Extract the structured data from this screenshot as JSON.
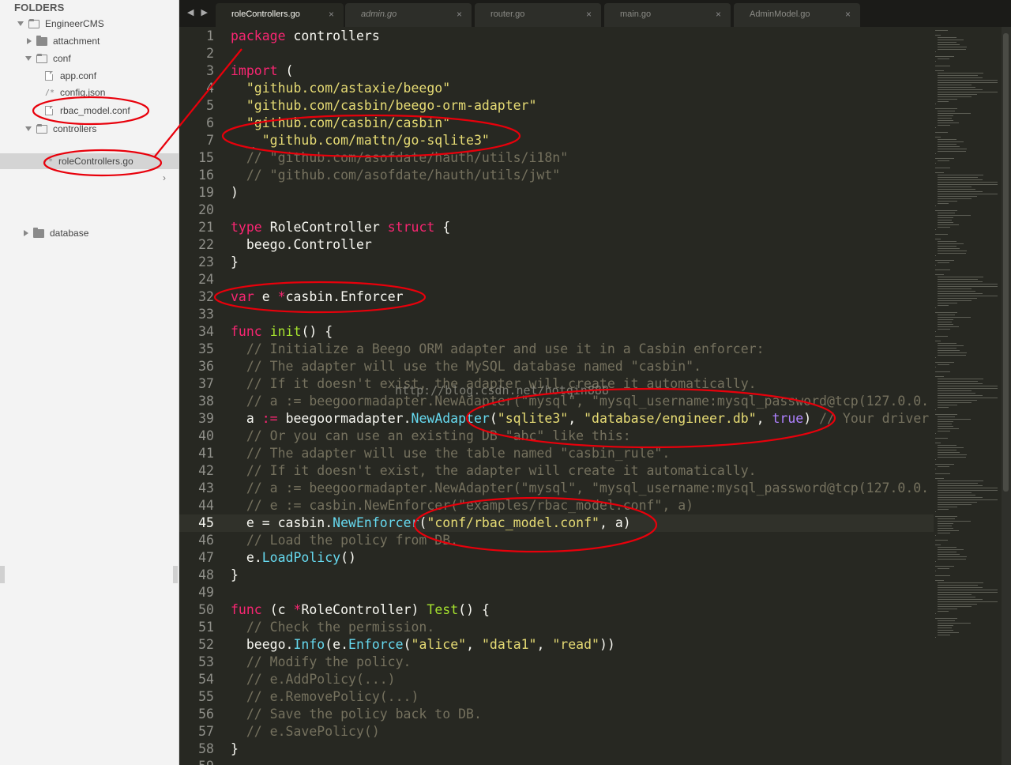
{
  "sidebar": {
    "header": "FOLDERS",
    "items": [
      {
        "label": "EngineerCMS",
        "kind": "folder-open"
      },
      {
        "label": "attachment",
        "kind": "folder"
      },
      {
        "label": "conf",
        "kind": "folder-open"
      },
      {
        "label": "app.conf",
        "kind": "file"
      },
      {
        "label": "config.json",
        "kind": "code-file",
        "glyph": "/*"
      },
      {
        "label": "rbac_model.conf",
        "kind": "file"
      },
      {
        "label": "controllers",
        "kind": "folder-open"
      },
      {
        "label": "roleControllers.go",
        "kind": "code-file",
        "glyph": "/*"
      },
      {
        "label": "database",
        "kind": "folder"
      }
    ],
    "collapse_chevron": "›"
  },
  "tabs": [
    {
      "label": "roleControllers.go",
      "active": true
    },
    {
      "label": "admin.go",
      "active": false
    },
    {
      "label": "router.go",
      "active": false
    },
    {
      "label": "main.go",
      "active": false
    },
    {
      "label": "AdminModel.go",
      "active": false
    }
  ],
  "tab_close_glyph": "×",
  "nav_arrows": "◀ ▶",
  "editor": {
    "current_line": "45",
    "lines": [
      {
        "n": "1",
        "text": "package controllers"
      },
      {
        "n": "2",
        "text": ""
      },
      {
        "n": "3",
        "text": "import ("
      },
      {
        "n": "4",
        "text": "  \"github.com/astaxie/beego\""
      },
      {
        "n": "5",
        "text": "  \"github.com/casbin/beego-orm-adapter\""
      },
      {
        "n": "6",
        "text": "  \"github.com/casbin/casbin\""
      },
      {
        "n": "7",
        "text": "  _ \"github.com/mattn/go-sqlite3\""
      },
      {
        "n": "15",
        "text": "  // \"github.com/asofdate/hauth/utils/i18n\""
      },
      {
        "n": "16",
        "text": "  // \"github.com/asofdate/hauth/utils/jwt\""
      },
      {
        "n": "19",
        "text": ")"
      },
      {
        "n": "20",
        "text": ""
      },
      {
        "n": "21",
        "text": "type RoleController struct {"
      },
      {
        "n": "22",
        "text": "  beego.Controller"
      },
      {
        "n": "23",
        "text": "}"
      },
      {
        "n": "24",
        "text": ""
      },
      {
        "n": "32",
        "text": "var e *casbin.Enforcer"
      },
      {
        "n": "33",
        "text": ""
      },
      {
        "n": "34",
        "text": "func init() {"
      },
      {
        "n": "35",
        "text": "  // Initialize a Beego ORM adapter and use it in a Casbin enforcer:"
      },
      {
        "n": "36",
        "text": "  // The adapter will use the MySQL database named \"casbin\"."
      },
      {
        "n": "37",
        "text": "  // If it doesn't exist, the adapter will create it automatically."
      },
      {
        "n": "38",
        "text": "  // a := beegoormadapter.NewAdapter(\"mysql\", \"mysql_username:mysql_password@tcp(127.0.0."
      },
      {
        "n": "39",
        "text": "  a := beegoormadapter.NewAdapter(\"sqlite3\", \"database/engineer.db\", true) // Your driver"
      },
      {
        "n": "40",
        "text": "  // Or you can use an existing DB \"abc\" like this:"
      },
      {
        "n": "41",
        "text": "  // The adapter will use the table named \"casbin_rule\"."
      },
      {
        "n": "42",
        "text": "  // If it doesn't exist, the adapter will create it automatically."
      },
      {
        "n": "43",
        "text": "  // a := beegoormadapter.NewAdapter(\"mysql\", \"mysql_username:mysql_password@tcp(127.0.0."
      },
      {
        "n": "44",
        "text": "  // e := casbin.NewEnforcer(\"examples/rbac_model.conf\", a)"
      },
      {
        "n": "45",
        "text": "  e = casbin.NewEnforcer(\"conf/rbac_model.conf\", a)"
      },
      {
        "n": "46",
        "text": "  // Load the policy from DB."
      },
      {
        "n": "47",
        "text": "  e.LoadPolicy()"
      },
      {
        "n": "48",
        "text": "}"
      },
      {
        "n": "49",
        "text": ""
      },
      {
        "n": "50",
        "text": "func (c *RoleController) Test() {"
      },
      {
        "n": "51",
        "text": "  // Check the permission."
      },
      {
        "n": "52",
        "text": "  beego.Info(e.Enforce(\"alice\", \"data1\", \"read\"))"
      },
      {
        "n": "53",
        "text": "  // Modify the policy."
      },
      {
        "n": "54",
        "text": "  // e.AddPolicy(...)"
      },
      {
        "n": "55",
        "text": "  // e.RemovePolicy(...)"
      },
      {
        "n": "56",
        "text": "  // Save the policy back to DB."
      },
      {
        "n": "57",
        "text": "  // e.SavePolicy()"
      },
      {
        "n": "58",
        "text": "}"
      },
      {
        "n": "59",
        "text": ""
      }
    ]
  },
  "watermark": "http://blog.csdn.net/hotqin888",
  "annotation_color": "#e8000b"
}
